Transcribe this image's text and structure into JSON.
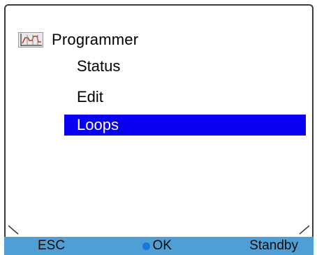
{
  "header": {
    "icon": "programmer-chart-icon",
    "title": "Programmer"
  },
  "menu": {
    "items": [
      {
        "label": "Status",
        "selected": false
      },
      {
        "label": "Edit",
        "selected": false
      },
      {
        "label": "Loops",
        "selected": true
      }
    ]
  },
  "softkeys": {
    "esc_label": "ESC",
    "ok_label": "OK",
    "standby_label": "Standby"
  },
  "colors": {
    "selection_bg": "#0a00f0",
    "footer_bg": "#4f9fd6",
    "ok_dot": "#1a78d8"
  }
}
